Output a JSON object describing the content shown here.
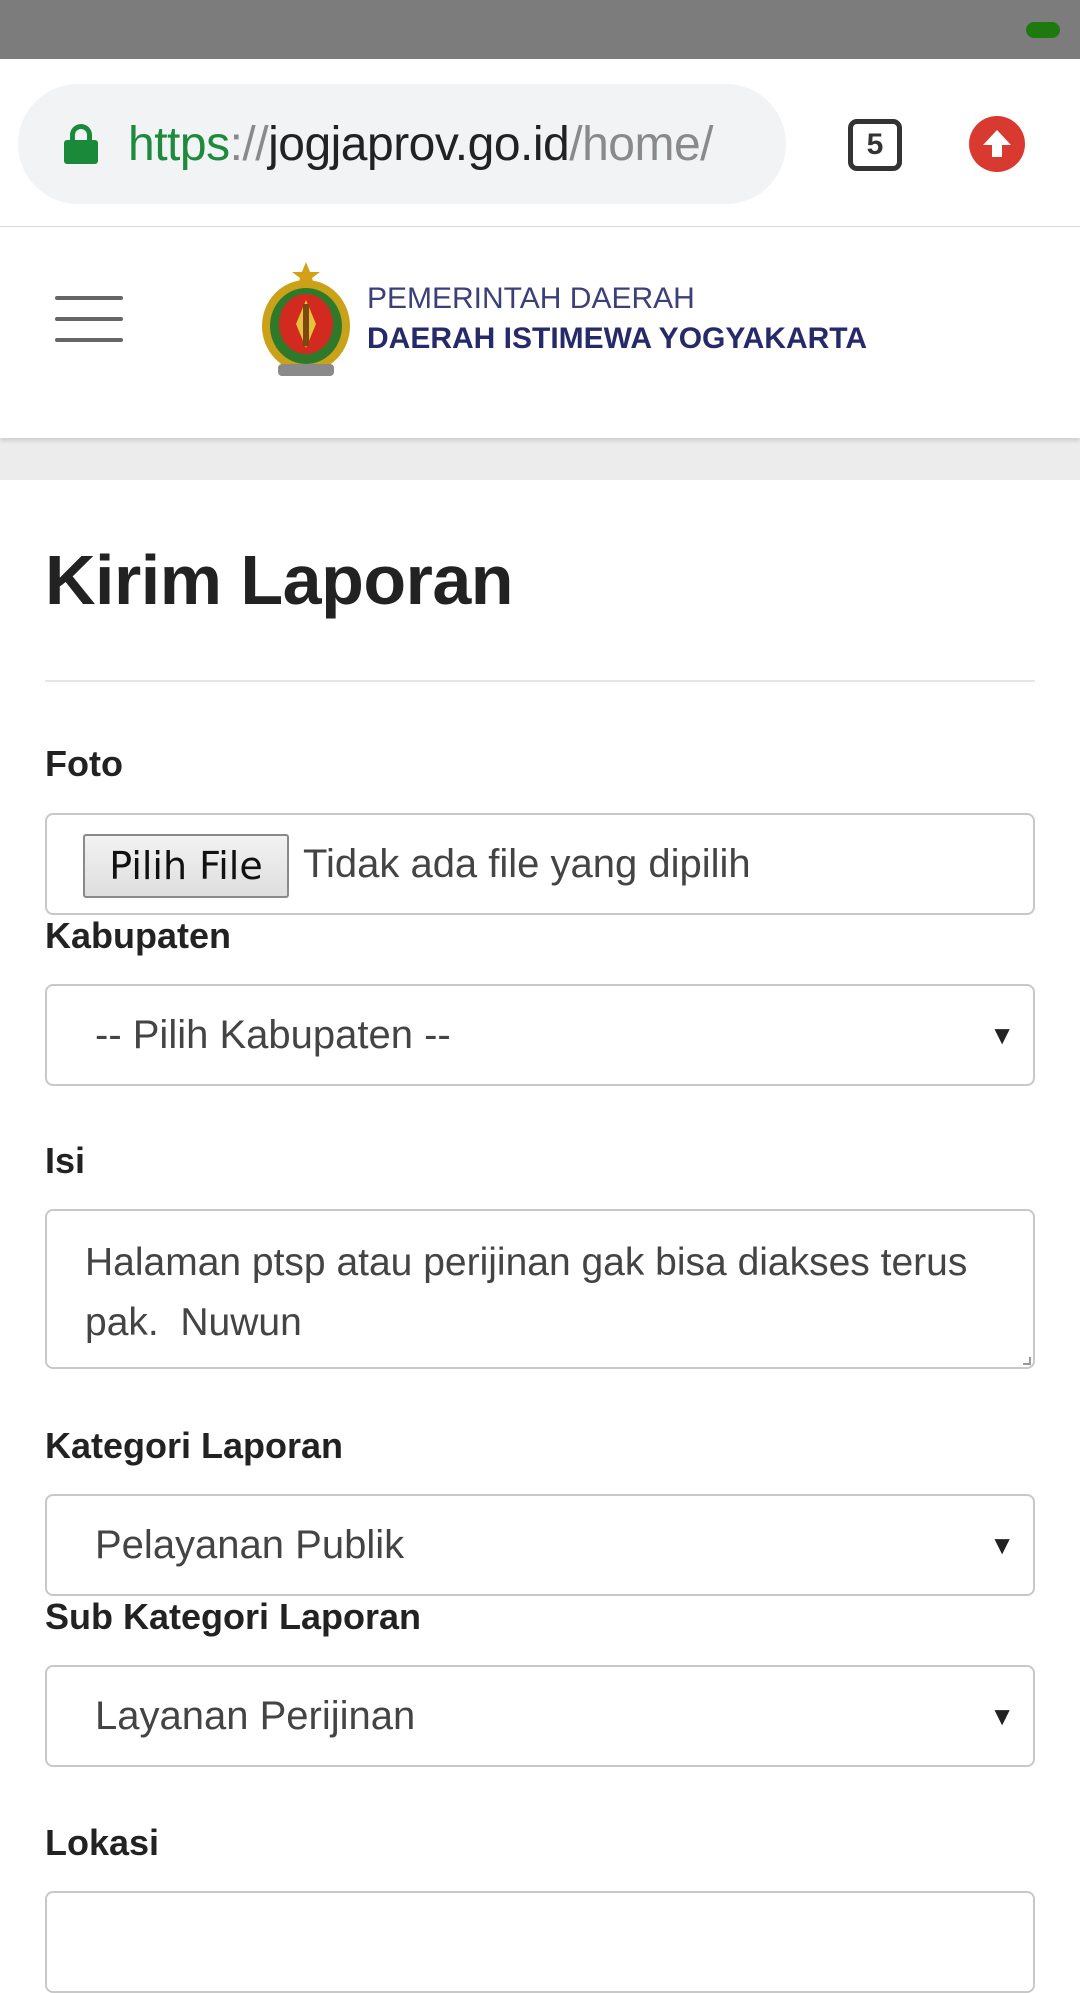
{
  "browser": {
    "url_scheme": "https",
    "url_sep": "://",
    "url_host": "jogjaprov.go.id",
    "url_path": "/home/",
    "tab_count": "5"
  },
  "site": {
    "brand_line1": "PEMERINTAH DAERAH",
    "brand_line2": "DAERAH ISTIMEWA YOGYAKARTA"
  },
  "form": {
    "title": "Kirim Laporan",
    "foto_label": "Foto",
    "file_button": "Pilih File",
    "file_status": "Tidak ada file yang dipilih",
    "kabupaten_label": "Kabupaten",
    "kabupaten_value": "-- Pilih Kabupaten --",
    "isi_label": "Isi",
    "isi_value": "Halaman ptsp atau perijinan gak bisa diakses terus pak.  Nuwun",
    "kategori_label": "Kategori Laporan",
    "kategori_value": "Pelayanan Publik",
    "subkategori_label": "Sub Kategori Laporan",
    "subkategori_value": "Layanan Perijinan",
    "lokasi_label": "Lokasi",
    "caret": "▼"
  },
  "colors": {
    "secure_green": "#1e8a3c",
    "status_bar": "#7c7c7c",
    "update_red": "#d93a30"
  },
  "icons": [
    "lock-icon",
    "tabs-icon",
    "update-icon",
    "hamburger-icon",
    "logo-emblem"
  ]
}
